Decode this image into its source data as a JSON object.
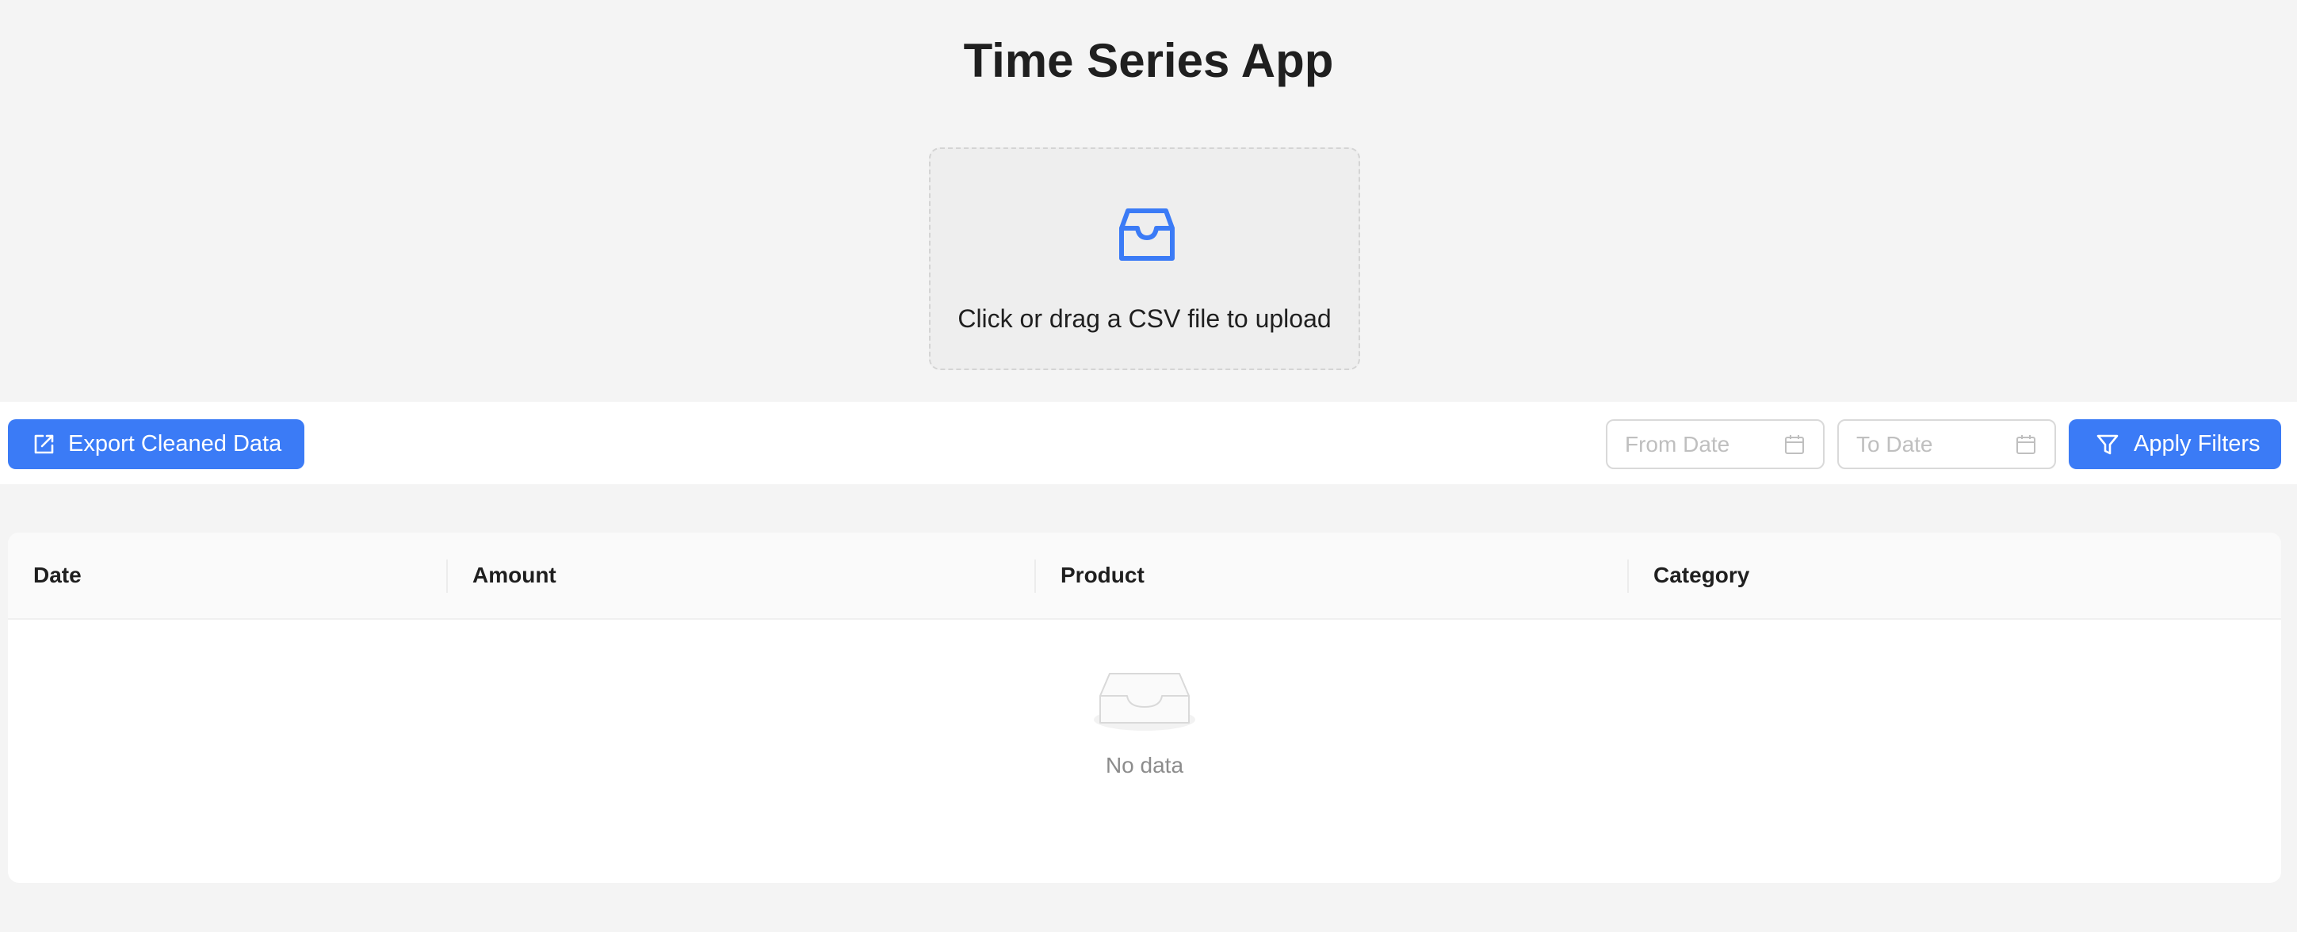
{
  "app": {
    "title": "Time Series App"
  },
  "upload": {
    "prompt": "Click or drag a CSV file to upload",
    "icon": "inbox-icon"
  },
  "toolbar": {
    "export_label": "Export Cleaned Data",
    "from_placeholder": "From Date",
    "to_placeholder": "To Date",
    "apply_label": "Apply Filters"
  },
  "table": {
    "columns": [
      "Date",
      "Amount",
      "Product",
      "Category"
    ],
    "empty_text": "No data"
  },
  "colors": {
    "accent": "#3b7bf6",
    "background": "#f4f4f4",
    "surface": "#ffffff"
  }
}
